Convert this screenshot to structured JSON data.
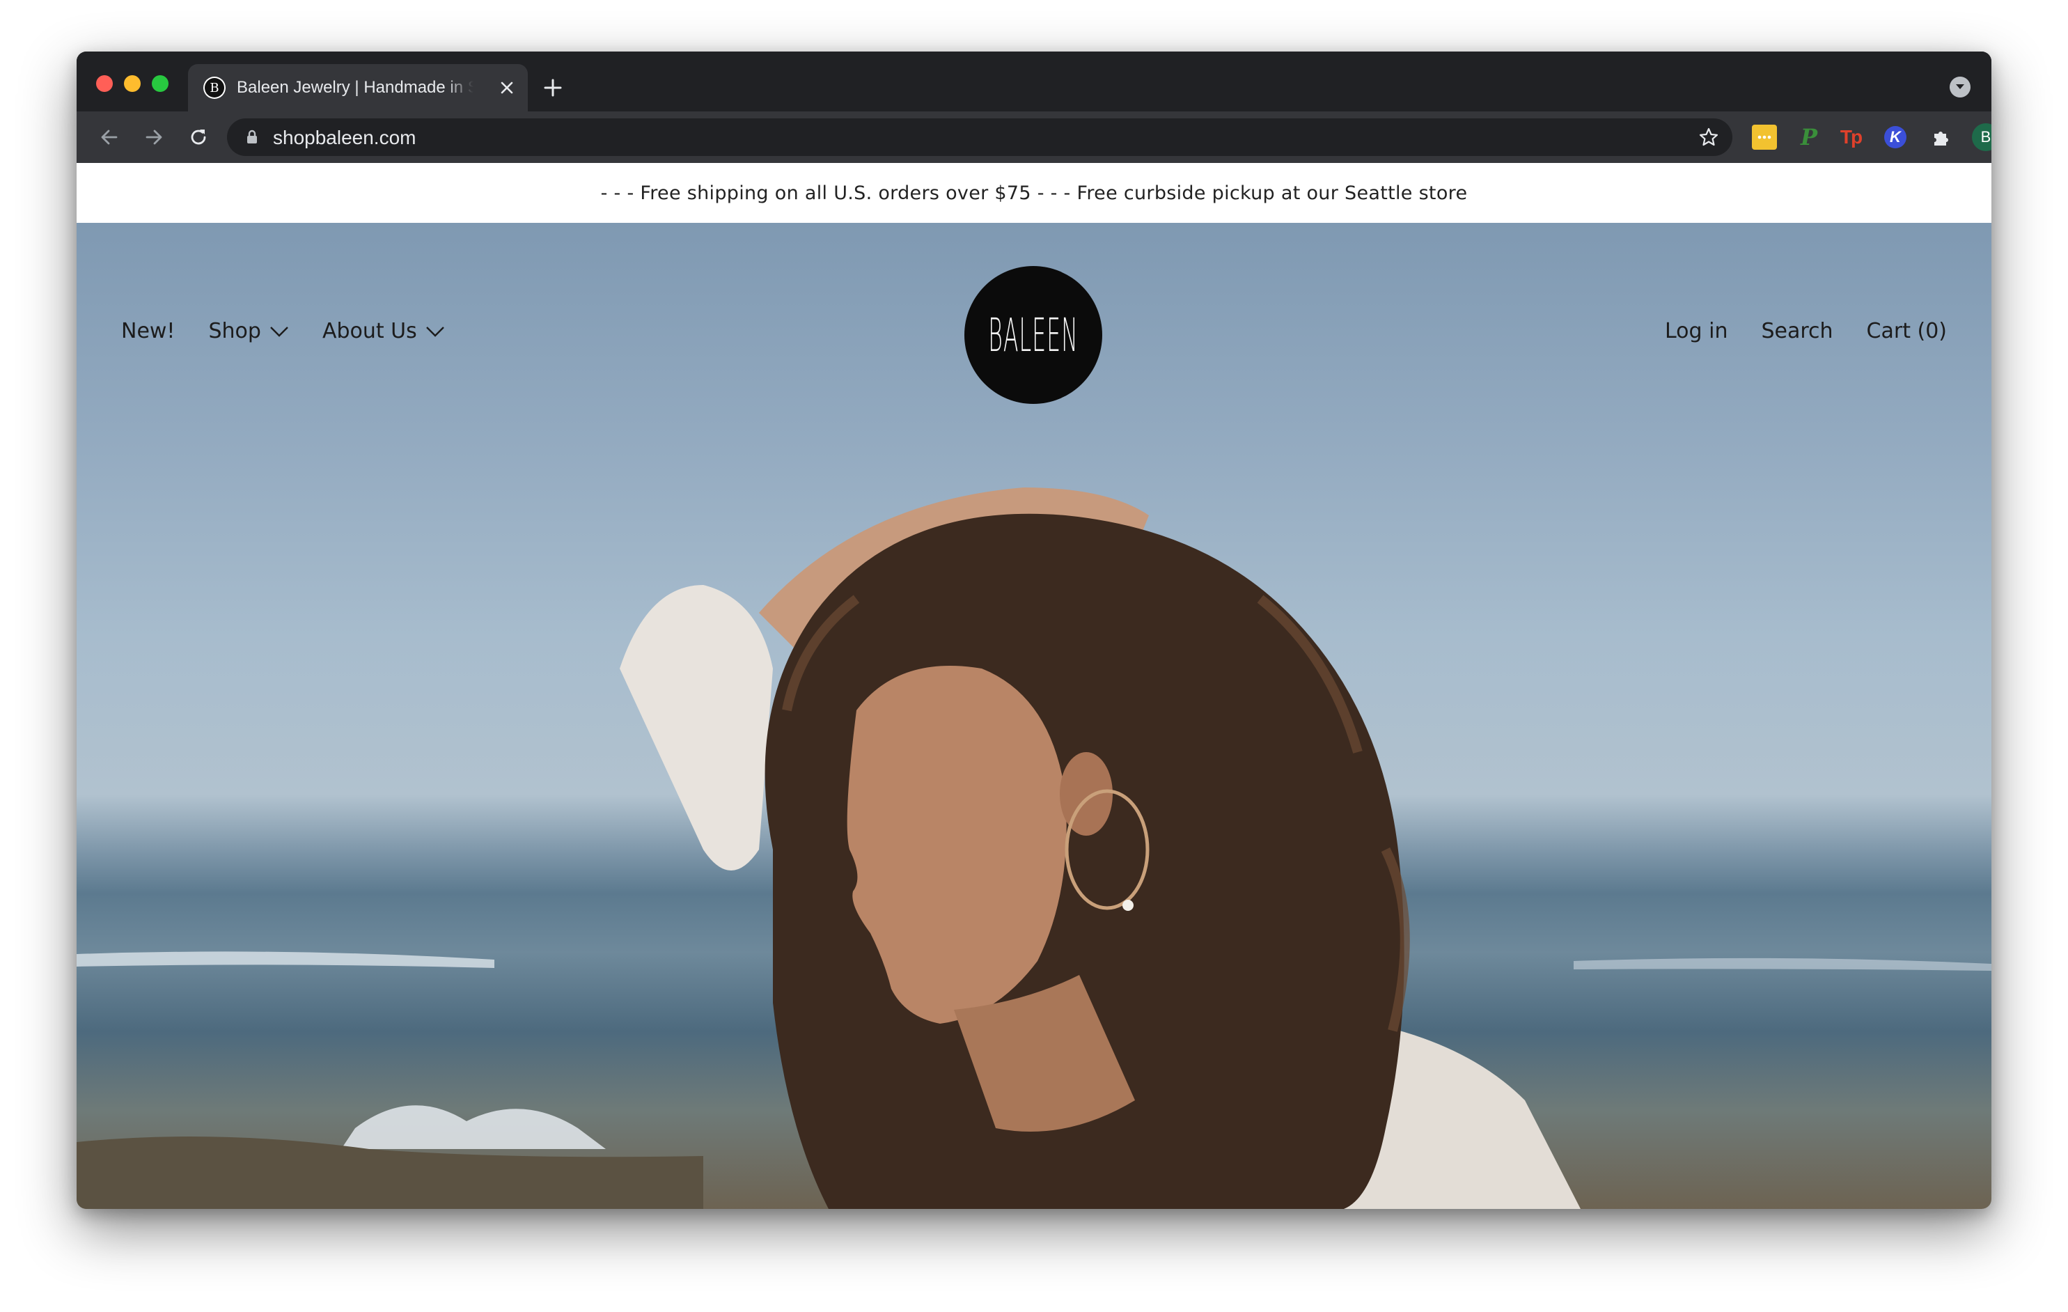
{
  "browser": {
    "tab": {
      "favicon_letter": "B",
      "title": "Baleen Jewelry | Handmade in Seattle"
    },
    "address_bar": {
      "url": "shopbaleen.com"
    },
    "extensions": [
      {
        "name": "sticky-notes-extension",
        "glyph": "…",
        "color": "#f2c230"
      },
      {
        "name": "p-extension",
        "glyph": "P",
        "color": "#3a8f3a"
      },
      {
        "name": "tp-extension",
        "glyph": "Tp",
        "color": "#e0412b"
      },
      {
        "name": "k-extension",
        "glyph": "K",
        "color": "#3b4fd8"
      }
    ],
    "profile_initial": "B"
  },
  "site": {
    "announcement": "- - - Free shipping on all U.S. orders over $75 - - - Free curbside pickup at our Seattle store",
    "logo_text": "BALEEN",
    "nav_left": {
      "new": "New!",
      "shop": "Shop",
      "about": "About Us"
    },
    "nav_right": {
      "login": "Log in",
      "search": "Search",
      "cart": "Cart (0)"
    }
  },
  "colors": {
    "browser_frame": "#202124",
    "toolbar": "#35363a",
    "sky": "#93aac0",
    "ocean": "#4d6a7e",
    "logo_bg": "#0b0b0b"
  }
}
